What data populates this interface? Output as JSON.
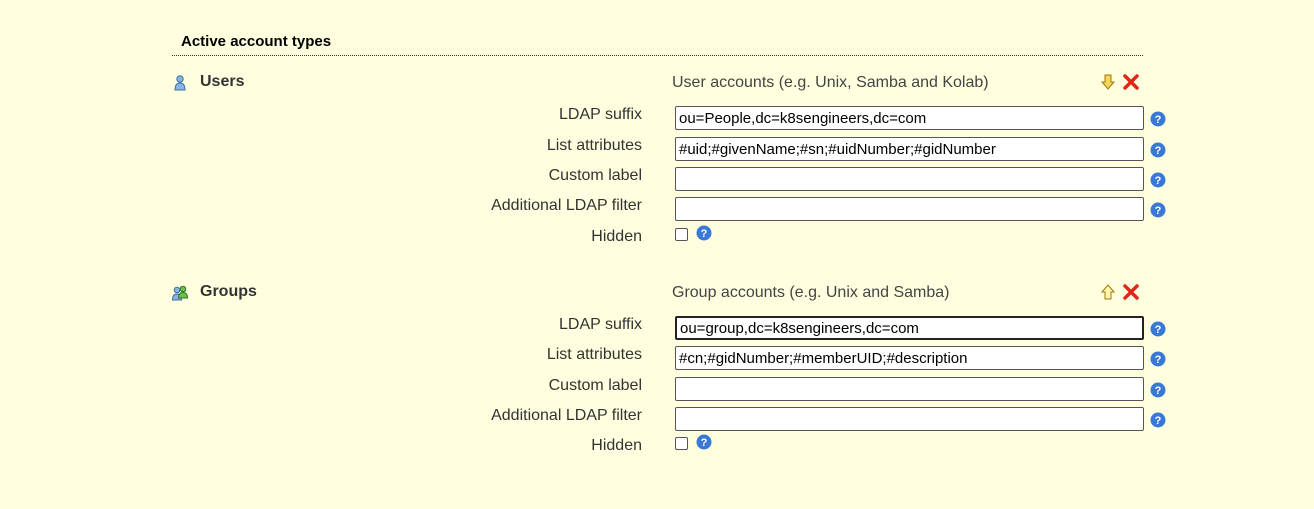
{
  "section": {
    "title": "Active account types"
  },
  "types": [
    {
      "name": "Users",
      "description": "User accounts (e.g. Unix, Samba and Kolab)",
      "move_icon": "arrow-down-icon",
      "fields": {
        "ldap_suffix": {
          "label": "LDAP suffix",
          "value": "ou=People,dc=k8sengineers,dc=com"
        },
        "list_attributes": {
          "label": "List attributes",
          "value": "#uid;#givenName;#sn;#uidNumber;#gidNumber"
        },
        "custom_label": {
          "label": "Custom label",
          "value": ""
        },
        "additional_filter": {
          "label": "Additional LDAP filter",
          "value": ""
        },
        "hidden": {
          "label": "Hidden",
          "checked": false
        }
      }
    },
    {
      "name": "Groups",
      "description": "Group accounts (e.g. Unix and Samba)",
      "move_icon": "arrow-up-icon",
      "fields": {
        "ldap_suffix": {
          "label": "LDAP suffix",
          "value": "ou=group,dc=k8sengineers,dc=com"
        },
        "list_attributes": {
          "label": "List attributes",
          "value": "#cn;#gidNumber;#memberUID;#description"
        },
        "custom_label": {
          "label": "Custom label",
          "value": ""
        },
        "additional_filter": {
          "label": "Additional LDAP filter",
          "value": ""
        },
        "hidden": {
          "label": "Hidden",
          "checked": false
        }
      }
    }
  ],
  "colors": {
    "background": "#ffffe0",
    "help_blue": "#3a78d8",
    "delete_red": "#e0281a",
    "arrow_yellow": "#f0c020"
  }
}
